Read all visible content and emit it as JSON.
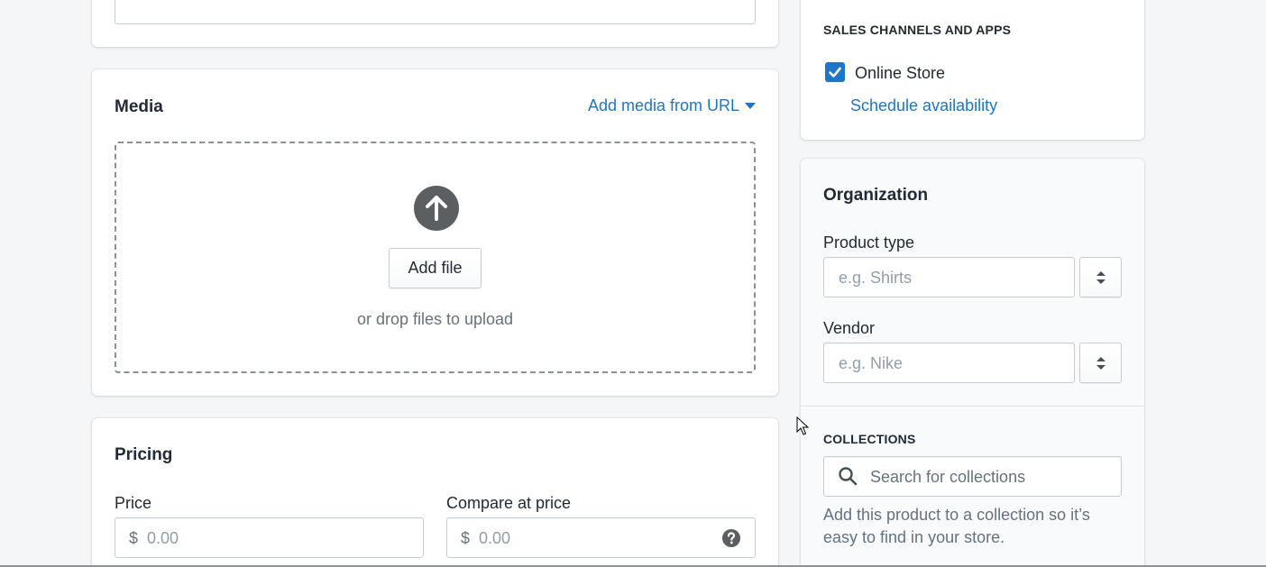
{
  "media": {
    "title": "Media",
    "add_from_url": "Add media from URL",
    "add_file": "Add file",
    "drop_hint": "or drop files to upload"
  },
  "pricing": {
    "title": "Pricing",
    "price_label": "Price",
    "price_currency": "$",
    "price_placeholder": "0.00",
    "compare_label": "Compare at price",
    "compare_currency": "$",
    "compare_placeholder": "0.00"
  },
  "sales_channels": {
    "heading": "SALES CHANNELS AND APPS",
    "online_store": "Online Store",
    "online_store_checked": true,
    "schedule": "Schedule availability"
  },
  "organization": {
    "title": "Organization",
    "product_type_label": "Product type",
    "product_type_placeholder": "e.g. Shirts",
    "vendor_label": "Vendor",
    "vendor_placeholder": "e.g. Nike",
    "collections_heading": "COLLECTIONS",
    "collections_placeholder": "Search for collections",
    "collections_help": "Add this product to a collection so it’s easy to find in your store."
  },
  "colors": {
    "link": "#1e76c8",
    "checkbox": "#1e76c8",
    "background": "#f4f6f8"
  },
  "icons": [
    "upload-arrow-icon",
    "caret-down-icon",
    "checkmark-icon",
    "stepper-icon",
    "search-icon",
    "help-circle-icon",
    "mouse-cursor-icon"
  ]
}
